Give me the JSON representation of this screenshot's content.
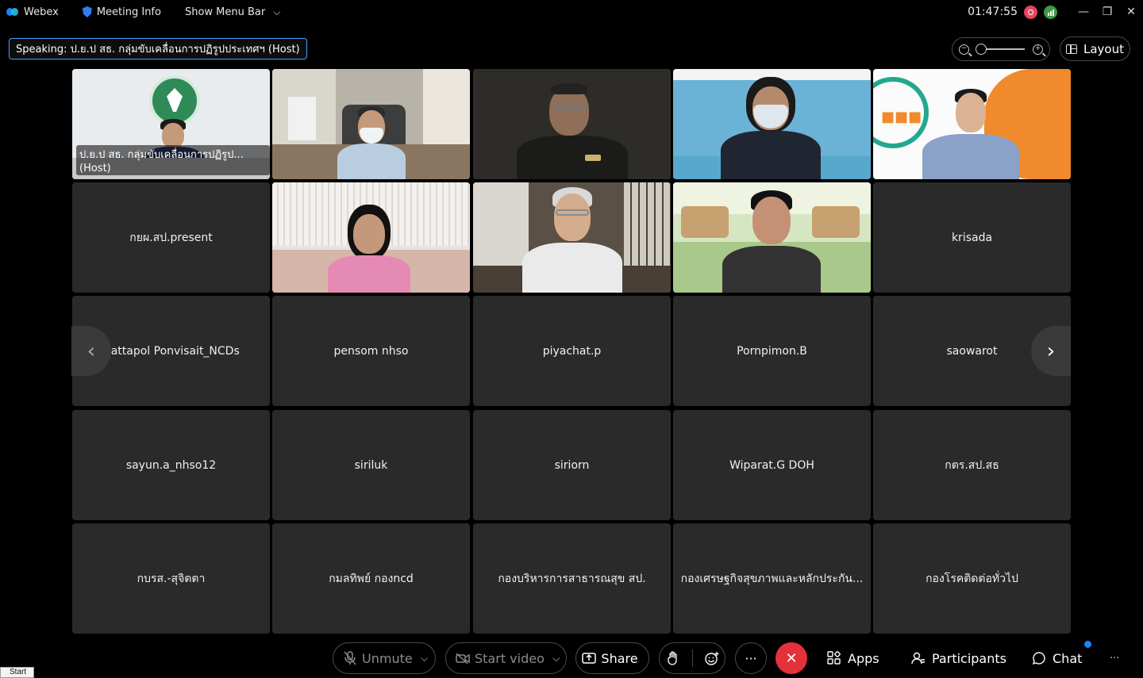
{
  "titlebar": {
    "app_name": "Webex",
    "meeting_info": "Meeting Info",
    "show_menu_bar": "Show Menu Bar",
    "clock": "01:47:55"
  },
  "speaking_label": "Speaking: ป.ย.ป สธ. กลุ่มขับเคลื่อนการปฏิรูปประเทศฯ (Host)",
  "layout_label": "Layout",
  "tiles": [
    {
      "name": "ป.ย.ป สธ. กลุ่มขับเคลื่อนการปฏิรูป... (Host)",
      "video": true
    },
    {
      "name": "",
      "video": true
    },
    {
      "name": "",
      "video": true
    },
    {
      "name": "",
      "video": true
    },
    {
      "name": "",
      "video": true
    },
    {
      "name": "กยผ.สป.present",
      "video": false
    },
    {
      "name": "",
      "video": true
    },
    {
      "name": "",
      "video": true
    },
    {
      "name": "",
      "video": true
    },
    {
      "name": "krisada",
      "video": false
    },
    {
      "name": "Nattapol Ponvisait_NCDs",
      "video": false
    },
    {
      "name": "pensom nhso",
      "video": false
    },
    {
      "name": "piyachat.p",
      "video": false
    },
    {
      "name": "Pornpimon.B",
      "video": false
    },
    {
      "name": "saowarot",
      "video": false
    },
    {
      "name": "sayun.a_nhso12",
      "video": false
    },
    {
      "name": "siriluk",
      "video": false
    },
    {
      "name": "siriorn",
      "video": false
    },
    {
      "name": "Wiparat.G DOH",
      "video": false
    },
    {
      "name": "กตร.สป.สธ",
      "video": false
    },
    {
      "name": "กบรส.-สุจิตตา",
      "video": false
    },
    {
      "name": "กมลทิพย์ กองncd",
      "video": false
    },
    {
      "name": "กองบริหารการสาธารณสุข สป.",
      "video": false
    },
    {
      "name": "กองเศรษฐกิจสุขภาพและหลักประกัน...",
      "video": false
    },
    {
      "name": "กองโรคติดต่อทั่วไป",
      "video": false
    }
  ],
  "toolbar": {
    "unmute": "Unmute",
    "start_video": "Start video",
    "share": "Share",
    "apps": "Apps",
    "participants": "Participants",
    "chat": "Chat",
    "more": "···"
  },
  "taskbar_start": "Start",
  "colors": {
    "active_border": "#5aa2ff",
    "end_button": "#e5323a",
    "tile_bg": "#2a2a2a"
  }
}
